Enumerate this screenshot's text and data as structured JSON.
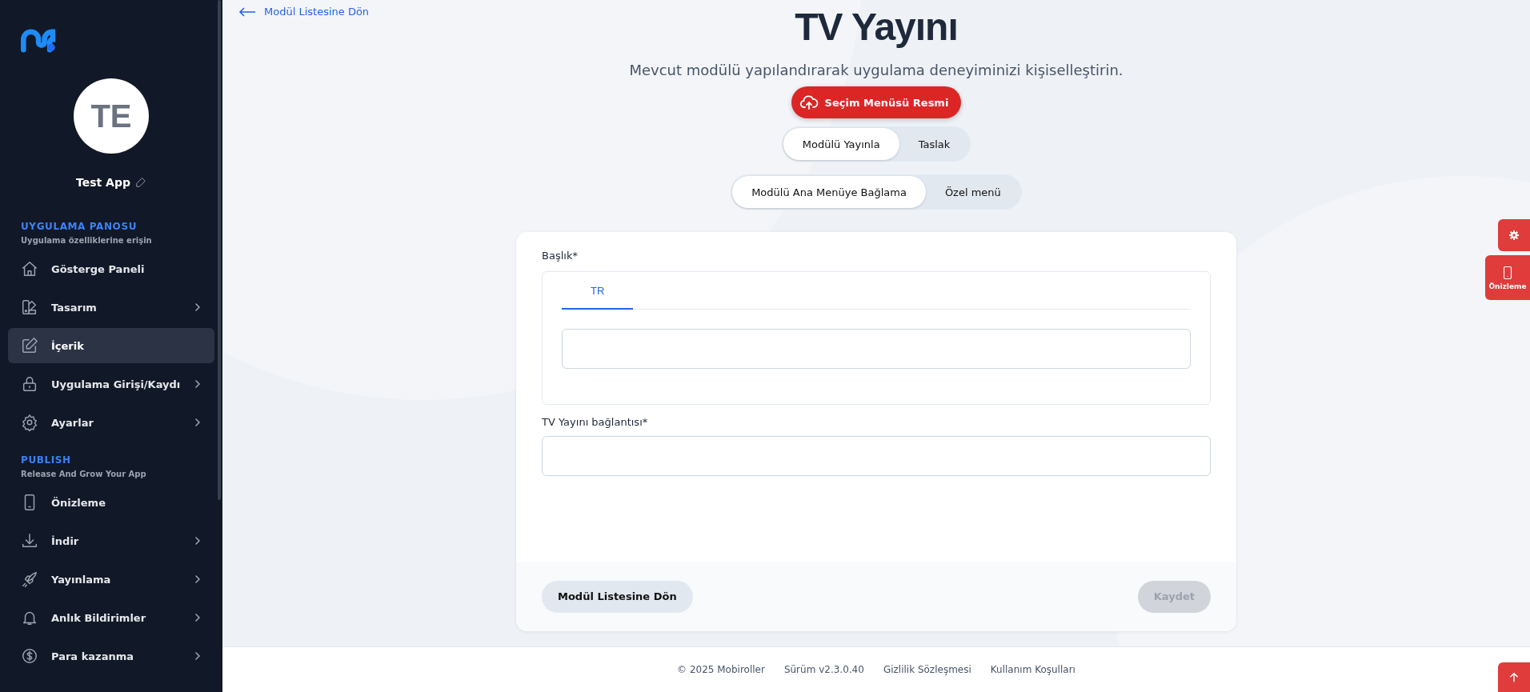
{
  "sidebar": {
    "app_initials": "TE",
    "app_name": "Test App",
    "sections": [
      {
        "title": "UYGULAMA PANOSU",
        "subtitle": "Uygulama özelliklerine erişin",
        "items": [
          {
            "label": "Gösterge Paneli",
            "selected": false,
            "has_submenu": false
          },
          {
            "label": "Tasarım",
            "selected": false,
            "has_submenu": true
          },
          {
            "label": "İçerik",
            "selected": true,
            "has_submenu": false
          },
          {
            "label": "Uygulama Girişi/Kaydı",
            "selected": false,
            "has_submenu": true
          },
          {
            "label": "Ayarlar",
            "selected": false,
            "has_submenu": true
          }
        ]
      },
      {
        "title": "PUBLISH",
        "subtitle": "Release And Grow Your App",
        "items": [
          {
            "label": "Önizleme",
            "selected": false,
            "has_submenu": false
          },
          {
            "label": "İndir",
            "selected": false,
            "has_submenu": true
          },
          {
            "label": "Yayınlama",
            "selected": false,
            "has_submenu": true
          },
          {
            "label": "Anlık Bildirimler",
            "selected": false,
            "has_submenu": true
          },
          {
            "label": "Para kazanma",
            "selected": false,
            "has_submenu": true
          }
        ]
      }
    ]
  },
  "back_link": "Modül Listesine Dön",
  "title": "TV Yayını",
  "subtitle": "Mevcut modülü yapılandırarak uygulama deneyiminizi kişiselleştirin.",
  "upload_button": "Seçim Menüsü Resmi",
  "publish_toggle": [
    {
      "label": "Modülü Yayınla",
      "selected": true
    },
    {
      "label": "Taslak",
      "selected": false
    }
  ],
  "menu_toggle": [
    {
      "label": "Modülü Ana Menüye Bağlama",
      "selected": true
    },
    {
      "label": "Özel menü",
      "selected": false
    }
  ],
  "form": {
    "title_label": "Başlık*",
    "language_tabs": [
      {
        "label": "TR",
        "selected": true
      }
    ],
    "link_label": "TV Yayını bağlantısı*",
    "back_button": "Modül Listesine Dön",
    "save_button": {
      "label": "Kaydet",
      "disabled": true
    }
  },
  "side_buttons": {
    "preview": "Önizleme"
  },
  "footer": [
    "© 2025 Mobiroller",
    "Sürüm v2.3.0.40",
    "Gizlilik Sözleşmesi",
    "Kullanım Koşulları"
  ]
}
